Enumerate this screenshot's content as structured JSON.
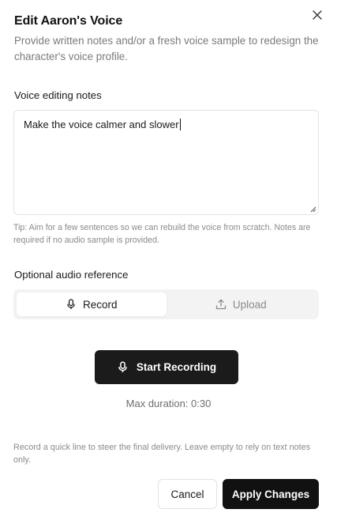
{
  "dialog": {
    "title": "Edit Aaron's Voice",
    "description": "Provide written notes and/or a fresh voice sample to redesign the character's voice profile.",
    "close_icon": "close-icon"
  },
  "notes": {
    "label": "Voice editing notes",
    "value": "Make the voice calmer and slower",
    "tip": "Tip: Aim for a few sentences so we can rebuild the voice from scratch. Notes are required if no audio sample is provided."
  },
  "audio": {
    "label": "Optional audio reference",
    "tabs": [
      {
        "label": "Record",
        "icon": "microphone-icon",
        "active": true
      },
      {
        "label": "Upload",
        "icon": "upload-icon",
        "active": false
      }
    ],
    "start_button": "Start Recording",
    "start_icon": "microphone-icon",
    "max_duration": "Max duration: 0:30",
    "footnote": "Record a quick line to steer the final delivery. Leave empty to rely on text notes only."
  },
  "actions": {
    "cancel": "Cancel",
    "apply": "Apply Changes"
  },
  "colors": {
    "primary_button": "#111111",
    "muted_text": "#8a8a8a",
    "border": "#e3e3e3",
    "segment_bg": "#f3f3f3"
  }
}
